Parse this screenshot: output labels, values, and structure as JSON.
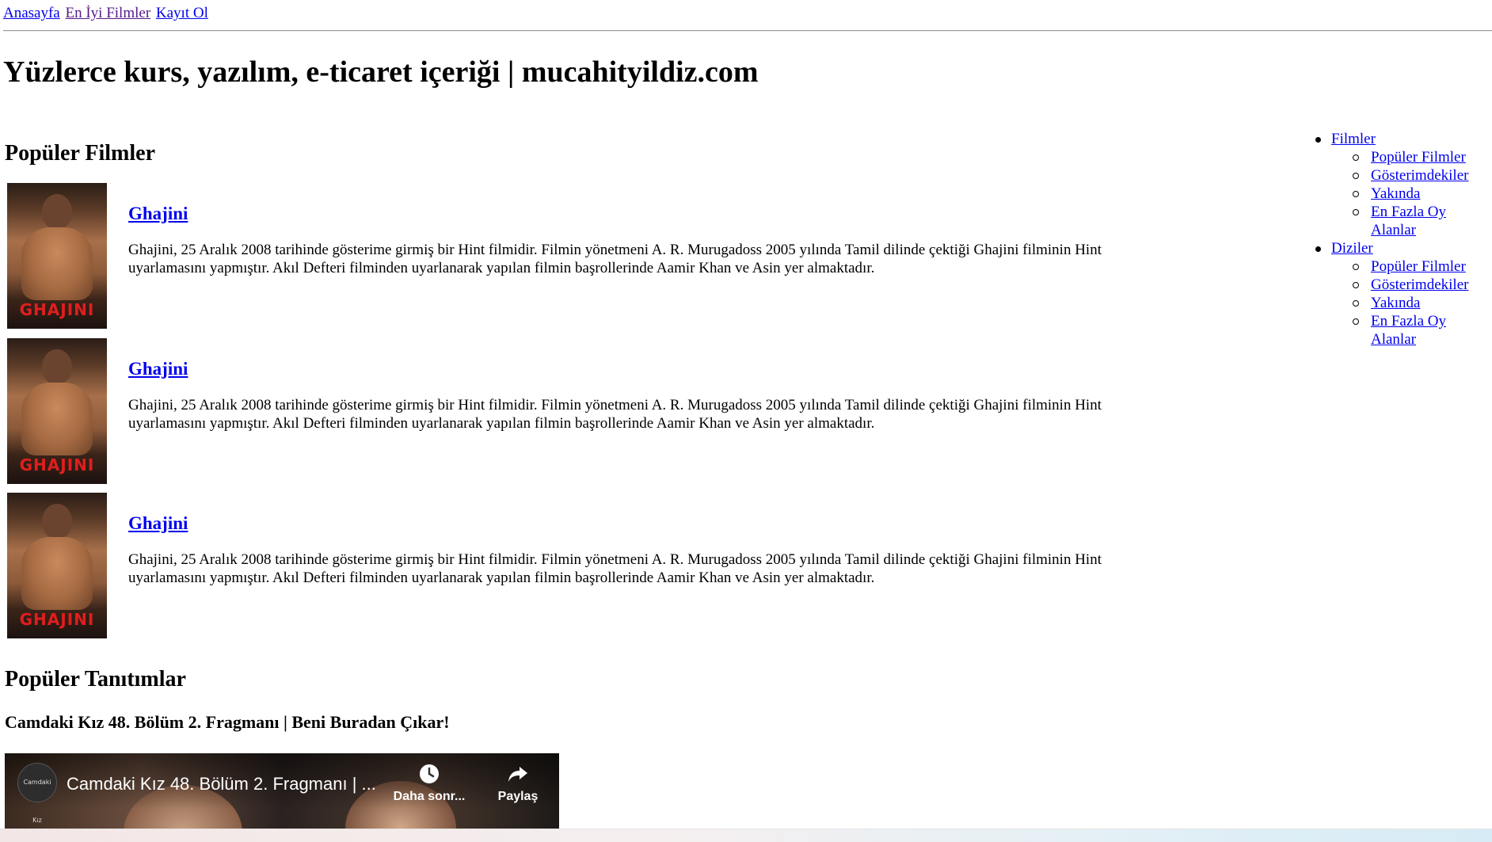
{
  "nav": {
    "links": [
      "Anasayfa",
      "En İyi Filmler",
      "Kayıt Ol"
    ]
  },
  "site_title": "Yüzlerce kurs, yazılım, e-ticaret içeriği | mucahityildiz.com",
  "popular_movies": {
    "heading": "Popüler Filmler",
    "items": [
      {
        "poster_text": "GHAJINI",
        "title": "Ghajini",
        "description": "Ghajini, 25 Aralık 2008 tarihinde gösterime girmiş bir Hint filmidir. Filmin yönetmeni A. R. Murugadoss 2005 yılında Tamil dilinde çektiği Ghajini filminin Hint uyarlamasını yapmıştır. Akıl Defteri filminden uyarlanarak yapılan filmin başrollerinde Aamir Khan ve Asin yer almaktadır."
      },
      {
        "poster_text": "GHAJINI",
        "title": "Ghajini",
        "description": "Ghajini, 25 Aralık 2008 tarihinde gösterime girmiş bir Hint filmidir. Filmin yönetmeni A. R. Murugadoss 2005 yılında Tamil dilinde çektiği Ghajini filminin Hint uyarlamasını yapmıştır. Akıl Defteri filminden uyarlanarak yapılan filmin başrollerinde Aamir Khan ve Asin yer almaktadır."
      },
      {
        "poster_text": "GHAJINI",
        "title": "Ghajini",
        "description": "Ghajini, 25 Aralık 2008 tarihinde gösterime girmiş bir Hint filmidir. Filmin yönetmeni A. R. Murugadoss 2005 yılında Tamil dilinde çektiği Ghajini filminin Hint uyarlamasını yapmıştır. Akıl Defteri filminden uyarlanarak yapılan filmin başrollerinde Aamir Khan ve Asin yer almaktadır."
      }
    ]
  },
  "popular_trailers": {
    "heading": "Popüler Tanıtımlar",
    "trailer_title": "Camdaki Kız 48. Bölüm 2. Fragmanı | Beni Buradan Çıkar!",
    "video": {
      "channel_avatar_text": "Camdaki Kız",
      "title": "Camdaki Kız 48. Bölüm 2. Fragmanı | ...",
      "watch_later_label": "Daha sonr...",
      "share_label": "Paylaş"
    }
  },
  "sidebar": {
    "groups": [
      {
        "label": "Filmler",
        "items": [
          "Popüler Filmler",
          "Gösterimdekiler",
          "Yakında",
          "En Fazla Oy Alanlar"
        ]
      },
      {
        "label": "Diziler",
        "items": [
          "Popüler Filmler",
          "Gösterimdekiler",
          "Yakında",
          "En Fazla Oy Alanlar"
        ]
      }
    ]
  },
  "colors": {
    "link": "#0000ee",
    "visited_link": "#551a8b",
    "poster_title": "#e01e1e"
  }
}
